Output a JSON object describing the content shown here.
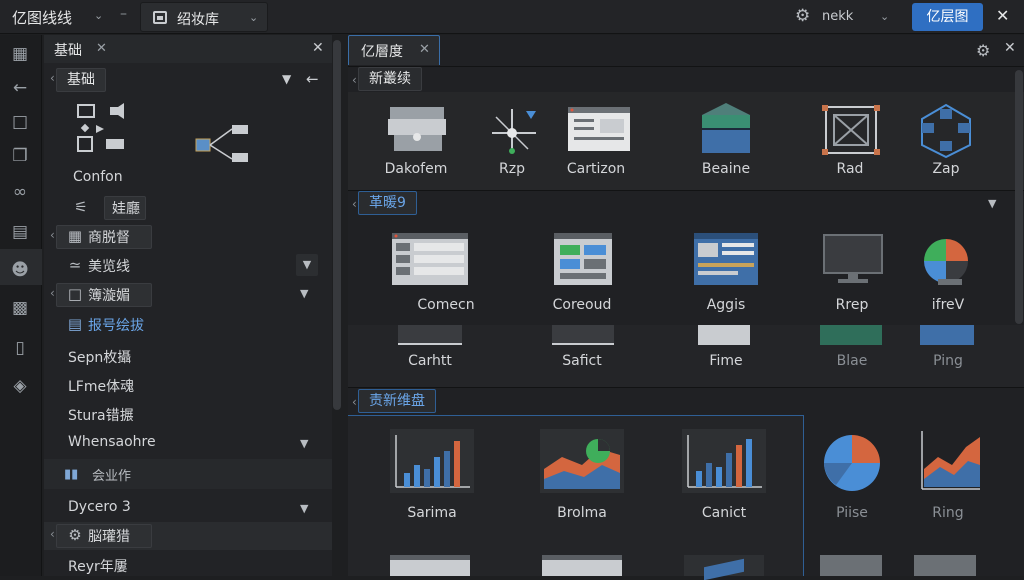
{
  "titlebar": {
    "app_title": "亿图线线",
    "file_tab_label": "绍妆库",
    "user_label": "nekk",
    "primary_button_label": "亿层图"
  },
  "left_panel": {
    "tab_label": "基础",
    "title_chip": "基础",
    "connector_label": "Confon",
    "items": [
      {
        "label": "娃廳"
      },
      {
        "label": "商脱督"
      },
      {
        "label": "美览线"
      },
      {
        "label": "簿漩媚"
      },
      {
        "label": "报号绘拔"
      },
      {
        "label": "Sepn枚攝"
      },
      {
        "label": "LFme体魂"
      },
      {
        "label": "Stura错搌"
      },
      {
        "label": "Whensaohre"
      }
    ],
    "group_label": "会业作",
    "dycero_label": "Dycero 3",
    "settings_item_label": "脳瓘猎",
    "last_item_label": "Reyr年屢"
  },
  "right_panel": {
    "tab_label": "亿層度",
    "section1_label": "新叢续",
    "section1_tiles": [
      {
        "label": "Dakofem",
        "icon": "database-icon"
      },
      {
        "label": "Rzp",
        "icon": "network-icon"
      },
      {
        "label": "Cartizon",
        "icon": "window-icon"
      },
      {
        "label": "Beaine",
        "icon": "layers-icon"
      },
      {
        "label": "Rad",
        "icon": "frame-icon"
      },
      {
        "label": "Zap",
        "icon": "graph-icon"
      }
    ],
    "section2_label": "革暖9",
    "section2_tiles": [
      {
        "label": "Comecn",
        "icon": "window-icon"
      },
      {
        "label": "Coreoud",
        "icon": "window-icon"
      },
      {
        "label": "Aggis",
        "icon": "window-icon"
      },
      {
        "label": "Rrep",
        "icon": "monitor-icon"
      },
      {
        "label": "ifreV",
        "icon": "pie-icon"
      }
    ],
    "section2_row2": [
      {
        "label": "Carhtt"
      },
      {
        "label": "Safict"
      },
      {
        "label": "Fime"
      },
      {
        "label": "Blae"
      },
      {
        "label": "Ping"
      }
    ],
    "section3_label": "责新维盘",
    "section3_tiles": [
      {
        "label": "Sarima",
        "icon": "bar-chart-icon"
      },
      {
        "label": "Brolma",
        "icon": "area-chart-icon"
      },
      {
        "label": "Canict",
        "icon": "bar-chart-icon"
      },
      {
        "label": "Piise",
        "icon": "pie-icon"
      },
      {
        "label": "Ring",
        "icon": "area-chart-icon"
      }
    ]
  }
}
